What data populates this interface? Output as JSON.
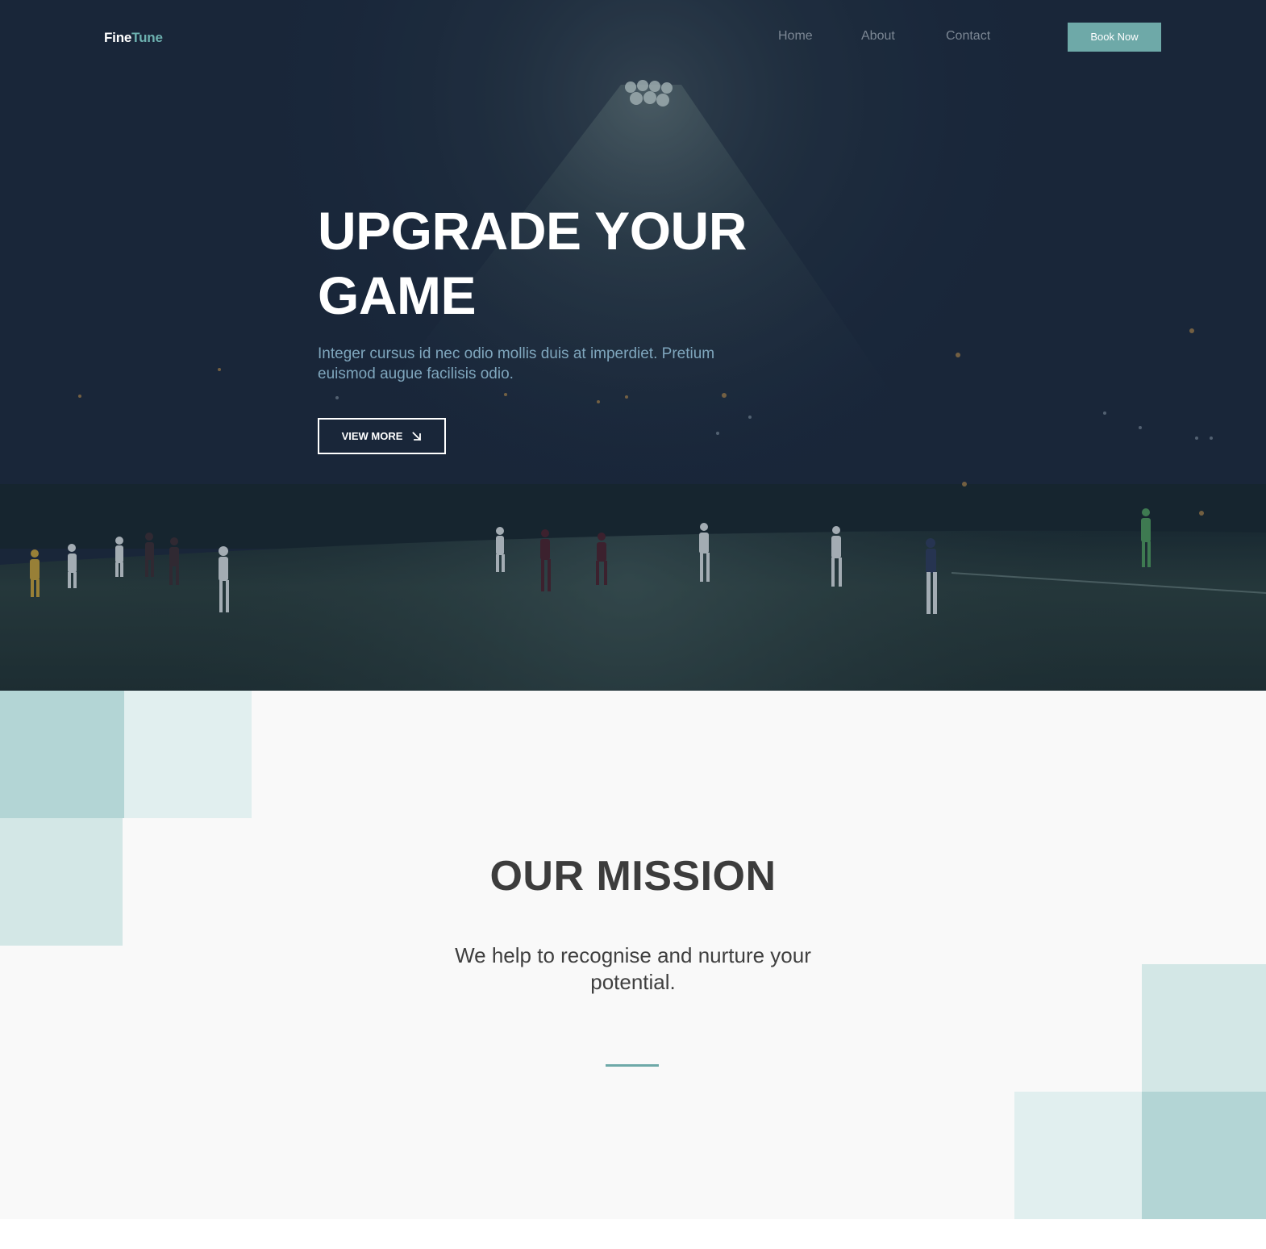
{
  "brand": {
    "logo_part1": "Fine",
    "logo_part2": "Tune"
  },
  "nav": {
    "links": [
      {
        "label": "Home"
      },
      {
        "label": "About"
      },
      {
        "label": "Contact"
      }
    ],
    "cta_label": "Book Now"
  },
  "hero": {
    "title": "UPGRADE YOUR GAME",
    "subtitle": "Integer cursus id nec odio mollis duis at imperdiet. Pretium euismod augue facilisis odio.",
    "button_label": "VIEW MORE",
    "button_icon": "arrow-down-right-icon",
    "background": "night-soccer-field-photo"
  },
  "mission": {
    "title": "OUR MISSION",
    "text": "We help to recognise and nurture your potential."
  },
  "colors": {
    "accent": "#6ea9a8",
    "hero_bg": "#19263a",
    "logo_accent": "#6db1b0",
    "subtitle": "#7fa6bd",
    "heading": "#3c3c3c",
    "section_bg": "#f9f9f9"
  }
}
